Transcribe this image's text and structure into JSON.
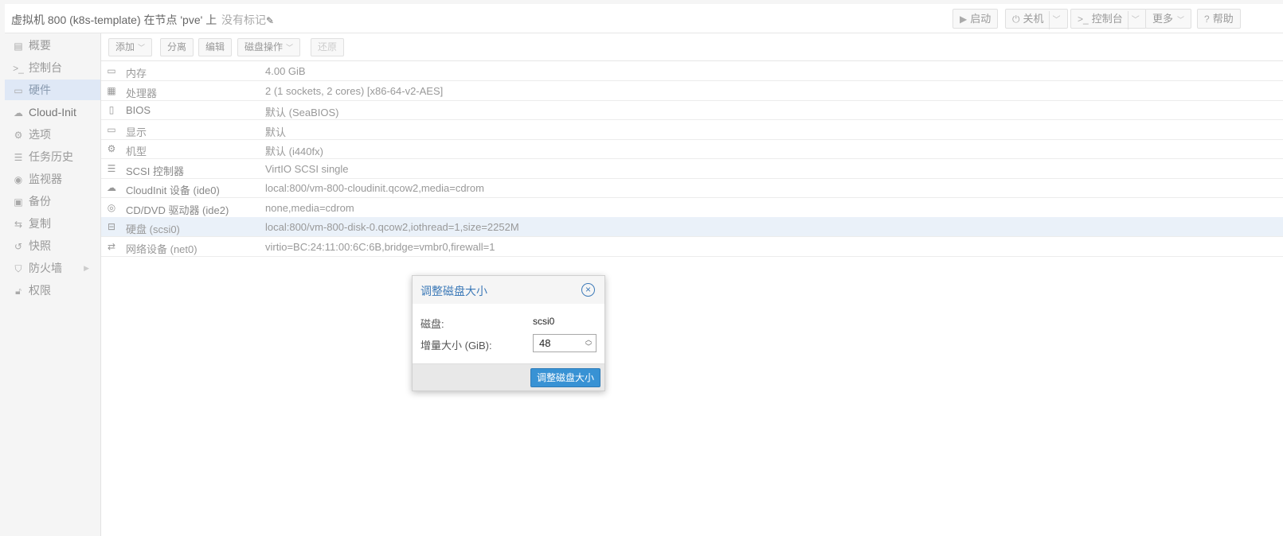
{
  "header": {
    "title": "虚拟机 800 (k8s-template) 在节点 'pve' 上",
    "tags_label": "没有标记",
    "buttons": {
      "start": "启动",
      "shutdown": "关机",
      "console": "控制台",
      "more": "更多",
      "help": "帮助"
    }
  },
  "sidebar": {
    "items": [
      {
        "label": "概要",
        "icon": "book-icon"
      },
      {
        "label": "控制台",
        "icon": "terminal-icon"
      },
      {
        "label": "硬件",
        "icon": "desktop-icon"
      },
      {
        "label": "Cloud-Init",
        "icon": "cloud-icon"
      },
      {
        "label": "选项",
        "icon": "gear-icon"
      },
      {
        "label": "任务历史",
        "icon": "list-icon"
      },
      {
        "label": "监视器",
        "icon": "eye-icon"
      },
      {
        "label": "备份",
        "icon": "floppy-icon"
      },
      {
        "label": "复制",
        "icon": "retweet-icon"
      },
      {
        "label": "快照",
        "icon": "history-icon"
      },
      {
        "label": "防火墙",
        "icon": "shield-icon"
      },
      {
        "label": "权限",
        "icon": "unlock-icon"
      }
    ],
    "active_index": 2
  },
  "toolbar": {
    "add": "添加",
    "detach": "分离",
    "edit": "编辑",
    "disk_action": "磁盘操作",
    "revert": "还原"
  },
  "hardware": {
    "rows": [
      {
        "key": "内存",
        "value": "4.00 GiB",
        "icon": "memory-icon"
      },
      {
        "key": "处理器",
        "value": "2 (1 sockets, 2 cores) [x86-64-v2-AES]",
        "icon": "cpu-icon"
      },
      {
        "key": "BIOS",
        "value": "默认 (SeaBIOS)",
        "icon": "chip-icon"
      },
      {
        "key": "显示",
        "value": "默认",
        "icon": "monitor-icon"
      },
      {
        "key": "机型",
        "value": "默认 (i440fx)",
        "icon": "cogs-icon"
      },
      {
        "key": "SCSI 控制器",
        "value": "VirtIO SCSI single",
        "icon": "database-icon"
      },
      {
        "key": "CloudInit 设备 (ide0)",
        "value": "local:800/vm-800-cloudinit.qcow2,media=cdrom",
        "icon": "cloud-icon"
      },
      {
        "key": "CD/DVD 驱动器 (ide2)",
        "value": "none,media=cdrom",
        "icon": "cdrom-icon"
      },
      {
        "key": "硬盘 (scsi0)",
        "value": "local:800/vm-800-disk-0.qcow2,iothread=1,size=2252M",
        "icon": "hdd-icon"
      },
      {
        "key": "网络设备 (net0)",
        "value": "virtio=BC:24:11:00:6C:6B,bridge=vmbr0,firewall=1",
        "icon": "exchange-icon"
      }
    ],
    "selected_index": 8
  },
  "dialog": {
    "title": "调整磁盘大小",
    "disk_label": "磁盘:",
    "disk_value": "scsi0",
    "size_label": "增量大小 (GiB):",
    "size_value": "48",
    "submit_label": "调整磁盘大小"
  },
  "colors": {
    "accent": "#3892d4",
    "dialog_title": "#3d7ab8",
    "selected_row": "#eaf1f9",
    "sidebar_active": "#dfe8f6"
  }
}
